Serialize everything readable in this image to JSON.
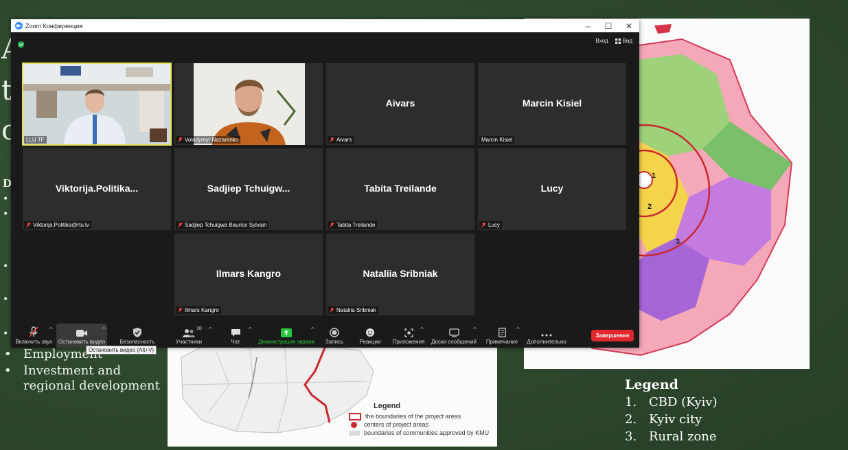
{
  "window": {
    "title": "Zoom Конференция"
  },
  "topbar": {
    "enter_label": "Вход",
    "view_label": "Вид"
  },
  "participants": [
    {
      "tile_name": "",
      "label": "LLU TF",
      "muted": false,
      "video": true
    },
    {
      "tile_name": "",
      "label": "Volodymyr Nazarenko",
      "muted": true,
      "video": true
    },
    {
      "tile_name": "Aivars",
      "label": "Aivars",
      "muted": true,
      "video": false
    },
    {
      "tile_name": "Marcin Kisiel",
      "label": "Marcin Kisiel",
      "muted": false,
      "video": false
    },
    {
      "tile_name": "Viktorija.Politika...",
      "label": "Viktorija.Politika@rtu.lv",
      "muted": true,
      "video": false
    },
    {
      "tile_name": "Sadjiep  Tchuigw...",
      "label": "Sadjiep Tchuigwa Baurice Sylvain",
      "muted": true,
      "video": false
    },
    {
      "tile_name": "Tabita Treilande",
      "label": "Tabita Treilande",
      "muted": true,
      "video": false
    },
    {
      "tile_name": "Lucy",
      "label": "Lucy",
      "muted": true,
      "video": false
    },
    {
      "tile_name": "Ilmars Kangro",
      "label": "Ilmars Kangro",
      "muted": true,
      "video": false
    },
    {
      "tile_name": "Nataliia Sribniak",
      "label": "Nataliia Sribniak",
      "muted": true,
      "video": false
    }
  ],
  "toolbar": {
    "unmute": "Включить звук",
    "stop_video": "Остановить видео",
    "security": "Безопасность",
    "participants": "Участники",
    "participants_count": "10",
    "chat": "Чат",
    "share": "Демонстрация экрана",
    "record": "Запись",
    "reactions": "Реакции",
    "apps": "Приложения",
    "whiteboards": "Доски сообщений",
    "notes": "Примечание",
    "more": "Дополнительно",
    "end": "Завершение"
  },
  "tooltip": "Остановить видео (Alt+V)",
  "slide": {
    "title_frags": [
      "A",
      "t",
      "c"
    ],
    "frag_d": "D",
    "bullets": [
      "Employment",
      "Investment and",
      "regional development"
    ],
    "left_map_legend": {
      "title": "Legend",
      "items": [
        "the boundaries of the project areas",
        "centers of project areas",
        "boundaries of communities approved by KMU"
      ]
    },
    "right_map_legend": {
      "title": "Legend",
      "items": [
        {
          "num": "1.",
          "text": "CBD (Kyiv)"
        },
        {
          "num": "2.",
          "text": "Kyiv city"
        },
        {
          "num": "3.",
          "text": "Rural zone"
        }
      ]
    },
    "map_zone_numbers": [
      "1",
      "2",
      "3"
    ]
  },
  "colors": {
    "end_button": "#e0282d",
    "share_green": "#28c83c",
    "active_speaker": "#e2e25a",
    "slide_bg": "#2e4a2e"
  }
}
